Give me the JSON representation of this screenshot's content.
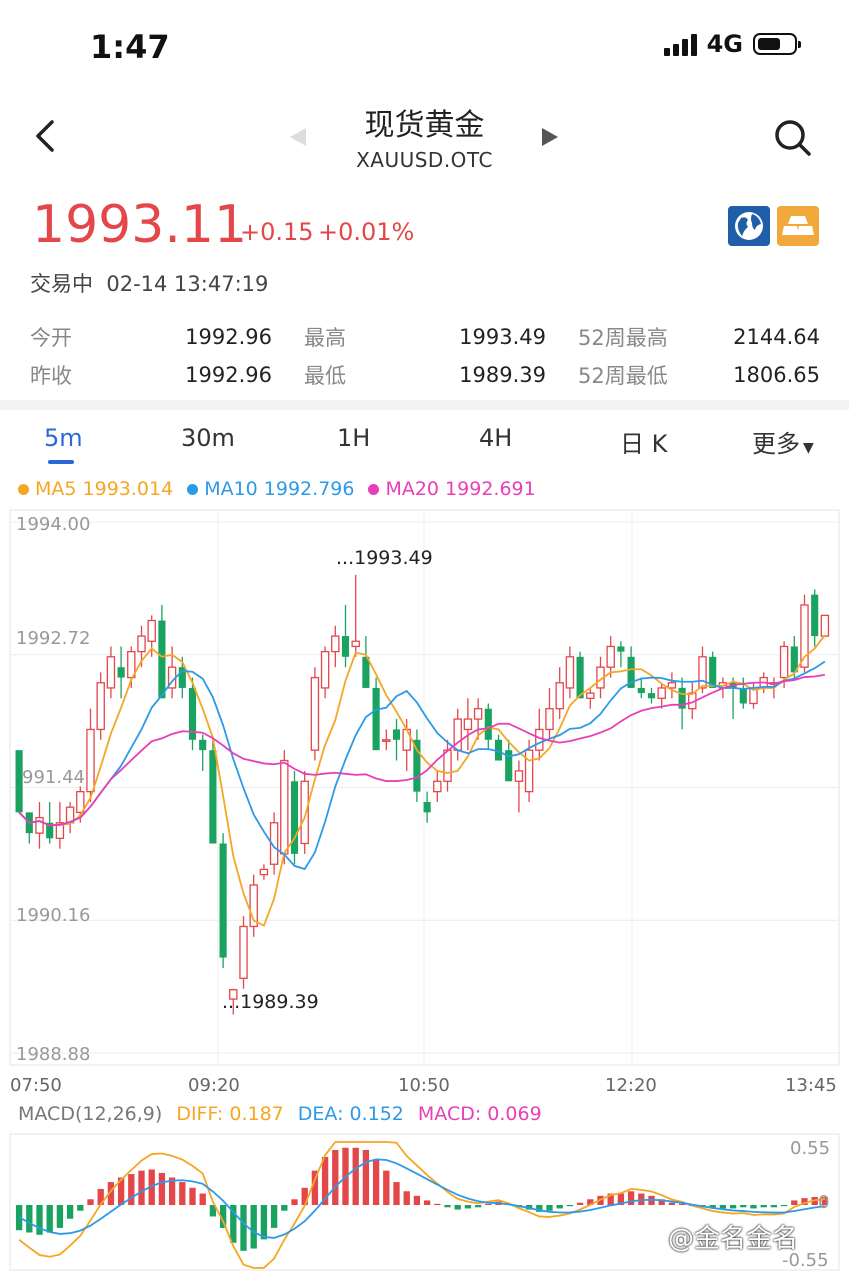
{
  "status_bar": {
    "time": "1:47",
    "network": "4G"
  },
  "header": {
    "title": "现货黄金",
    "symbol": "XAUUSD.OTC"
  },
  "quote": {
    "price": "1993.11",
    "change": "+0.15",
    "change_pct": "+0.01%",
    "trade_status": "交易中  02-14 13:47:19",
    "price_color": "#e3474a"
  },
  "stats": [
    {
      "label": "今开",
      "value": "1992.96",
      "label2": "最高",
      "value2": "1993.49",
      "label3": "52周最高",
      "value3": "2144.64"
    },
    {
      "label": "昨收",
      "value": "1992.96",
      "label2": "最低",
      "value2": "1989.39",
      "label3": "52周最低",
      "value3": "1806.65"
    }
  ],
  "tabs": [
    {
      "label": "5m",
      "active": true
    },
    {
      "label": "30m"
    },
    {
      "label": "1H"
    },
    {
      "label": "4H"
    },
    {
      "label": "日 K"
    },
    {
      "label": "更多"
    }
  ],
  "ma_legend": [
    {
      "label": "MA5 1993.014",
      "color": "#f5a623"
    },
    {
      "label": "MA10 1992.796",
      "color": "#2c9ae8"
    },
    {
      "label": "MA20 1992.691",
      "color": "#e83fb8"
    }
  ],
  "macd_legend": {
    "title": "MACD(12,26,9)",
    "diff": "DIFF: 0.187",
    "dea": "DEA: 0.152",
    "macd": "MACD: 0.069"
  },
  "watermark": "@金名金名",
  "chart_data": [
    {
      "type": "candlestick",
      "y_ticks": [
        "1994.00",
        "1992.72",
        "991.44",
        "1990.16",
        "1988.88"
      ],
      "ylim": [
        1988.88,
        1994.0
      ],
      "x_ticks": [
        "07:50",
        "09:20",
        "10:50",
        "12:20",
        "13:45"
      ],
      "annotations": {
        "high_label": "...1993.49",
        "low_label": "...1989.39"
      },
      "up_color": "#e3474a",
      "down_color": "#1aa260",
      "candles": [
        [
          1991.8,
          1991.8,
          1991.2,
          1991.2
        ],
        [
          1991.2,
          1991.2,
          1990.9,
          1991.0
        ],
        [
          1991.0,
          1991.3,
          1990.85,
          1991.15
        ],
        [
          1991.1,
          1991.3,
          1990.9,
          1990.95
        ],
        [
          1990.95,
          1991.3,
          1990.85,
          1991.1
        ],
        [
          1991.1,
          1991.3,
          1991.0,
          1991.25
        ],
        [
          1991.2,
          1991.45,
          1991.1,
          1991.4
        ],
        [
          1991.4,
          1992.2,
          1991.3,
          1992.0
        ],
        [
          1992.0,
          1992.55,
          1991.9,
          1992.45
        ],
        [
          1992.4,
          1992.8,
          1992.3,
          1992.7
        ],
        [
          1992.6,
          1992.8,
          1992.3,
          1992.5
        ],
        [
          1992.5,
          1992.8,
          1992.4,
          1992.75
        ],
        [
          1992.75,
          1993.0,
          1992.6,
          1992.9
        ],
        [
          1992.85,
          1993.1,
          1992.7,
          1993.05
        ],
        [
          1993.05,
          1993.2,
          1992.3,
          1992.3
        ],
        [
          1992.4,
          1992.8,
          1992.3,
          1992.6
        ],
        [
          1992.6,
          1992.7,
          1992.3,
          1992.4
        ],
        [
          1992.4,
          1992.5,
          1991.8,
          1991.9
        ],
        [
          1991.9,
          1991.95,
          1991.6,
          1991.8
        ],
        [
          1991.8,
          1991.9,
          1990.9,
          1990.9
        ],
        [
          1990.9,
          1991.0,
          1989.7,
          1989.8
        ],
        [
          1989.4,
          1989.5,
          1989.25,
          1989.49
        ],
        [
          1989.6,
          1990.2,
          1989.5,
          1990.1
        ],
        [
          1990.1,
          1990.6,
          1990.0,
          1990.5
        ],
        [
          1990.6,
          1990.7,
          1990.55,
          1990.65
        ],
        [
          1990.7,
          1991.2,
          1990.6,
          1991.1
        ],
        [
          1990.8,
          1991.8,
          1990.7,
          1991.7
        ],
        [
          1991.5,
          1991.6,
          1990.7,
          1990.8
        ],
        [
          1990.9,
          1991.6,
          1990.8,
          1991.5
        ],
        [
          1991.8,
          1992.6,
          1991.7,
          1992.5
        ],
        [
          1992.4,
          1992.8,
          1992.3,
          1992.75
        ],
        [
          1992.75,
          1993.0,
          1992.6,
          1992.9
        ],
        [
          1992.9,
          1993.2,
          1992.6,
          1992.7
        ],
        [
          1992.8,
          1993.49,
          1992.7,
          1992.85
        ],
        [
          1992.7,
          1992.9,
          1992.4,
          1992.4
        ],
        [
          1992.4,
          1992.5,
          1991.8,
          1991.8
        ],
        [
          1991.9,
          1992.0,
          1991.8,
          1991.9
        ],
        [
          1992.0,
          1992.1,
          1991.7,
          1991.9
        ],
        [
          1991.8,
          1992.1,
          1991.6,
          1992.0
        ],
        [
          1991.9,
          1992.0,
          1991.3,
          1991.4
        ],
        [
          1991.3,
          1991.4,
          1991.1,
          1991.2
        ],
        [
          1991.4,
          1991.6,
          1991.3,
          1991.5
        ],
        [
          1991.5,
          1991.9,
          1991.4,
          1991.8
        ],
        [
          1991.8,
          1992.2,
          1991.7,
          1992.1
        ],
        [
          1992.0,
          1992.3,
          1991.8,
          1992.1
        ],
        [
          1992.1,
          1992.3,
          1991.9,
          1992.2
        ],
        [
          1992.2,
          1992.25,
          1991.8,
          1991.9
        ],
        [
          1991.9,
          1991.95,
          1991.7,
          1991.7
        ],
        [
          1991.8,
          1991.9,
          1991.5,
          1991.5
        ],
        [
          1991.5,
          1991.7,
          1991.2,
          1991.6
        ],
        [
          1991.4,
          1991.9,
          1991.3,
          1991.8
        ],
        [
          1991.8,
          1992.2,
          1991.7,
          1992.0
        ],
        [
          1992.0,
          1992.4,
          1991.9,
          1992.2
        ],
        [
          1992.2,
          1992.6,
          1992.1,
          1992.45
        ],
        [
          1992.4,
          1992.8,
          1992.3,
          1992.7
        ],
        [
          1992.7,
          1992.75,
          1992.3,
          1992.3
        ],
        [
          1992.3,
          1992.4,
          1992.2,
          1992.35
        ],
        [
          1992.4,
          1992.7,
          1992.3,
          1992.6
        ],
        [
          1992.6,
          1992.9,
          1992.5,
          1992.8
        ],
        [
          1992.8,
          1992.85,
          1992.6,
          1992.75
        ],
        [
          1992.7,
          1992.8,
          1992.4,
          1992.4
        ],
        [
          1992.4,
          1992.5,
          1992.3,
          1992.35
        ],
        [
          1992.35,
          1992.4,
          1992.25,
          1992.3
        ],
        [
          1992.3,
          1992.45,
          1992.2,
          1992.4
        ],
        [
          1992.4,
          1992.55,
          1992.3,
          1992.45
        ],
        [
          1992.4,
          1992.5,
          1992.0,
          1992.2
        ],
        [
          1992.2,
          1992.45,
          1992.1,
          1992.35
        ],
        [
          1992.4,
          1992.8,
          1992.35,
          1992.7
        ],
        [
          1992.7,
          1992.75,
          1992.4,
          1992.4
        ],
        [
          1992.4,
          1992.5,
          1992.3,
          1992.45
        ],
        [
          1992.45,
          1992.5,
          1992.1,
          1992.4
        ],
        [
          1992.4,
          1992.5,
          1992.2,
          1992.25
        ],
        [
          1992.25,
          1992.45,
          1992.2,
          1992.4
        ],
        [
          1992.4,
          1992.55,
          1992.35,
          1992.5
        ],
        [
          1992.45,
          1992.5,
          1992.3,
          1992.45
        ],
        [
          1992.5,
          1992.85,
          1992.4,
          1992.8
        ],
        [
          1992.8,
          1992.9,
          1992.5,
          1992.55
        ],
        [
          1992.6,
          1993.3,
          1992.55,
          1993.2
        ],
        [
          1993.3,
          1993.35,
          1992.8,
          1992.9
        ],
        [
          1992.9,
          1993.1,
          1992.9,
          1993.1
        ]
      ]
    },
    {
      "type": "bar",
      "name": "MACD",
      "y_ticks": [
        "0.55",
        "0",
        "-0.55"
      ],
      "ylim": [
        -0.55,
        0.55
      ],
      "x_range": [
        0,
        79
      ],
      "values": [
        -0.22,
        -0.24,
        -0.26,
        -0.24,
        -0.2,
        -0.12,
        -0.05,
        0.05,
        0.14,
        0.2,
        0.24,
        0.27,
        0.3,
        0.31,
        0.28,
        0.24,
        0.2,
        0.15,
        0.1,
        -0.1,
        -0.2,
        -0.33,
        -0.4,
        -0.38,
        -0.3,
        -0.2,
        -0.05,
        0.05,
        0.15,
        0.3,
        0.42,
        0.48,
        0.5,
        0.5,
        0.48,
        0.4,
        0.3,
        0.2,
        0.12,
        0.08,
        0.04,
        0.01,
        -0.02,
        -0.04,
        -0.03,
        -0.02,
        0.01,
        0.03,
        0.01,
        -0.02,
        -0.04,
        -0.06,
        -0.05,
        -0.03,
        -0.01,
        0.02,
        0.05,
        0.08,
        0.1,
        0.1,
        0.12,
        0.1,
        0.08,
        0.05,
        0.02,
        0.01,
        -0.01,
        -0.02,
        -0.03,
        -0.03,
        -0.03,
        -0.02,
        -0.03,
        -0.02,
        -0.02,
        -0.01,
        0.04,
        0.06,
        0.07,
        0.069
      ]
    }
  ]
}
